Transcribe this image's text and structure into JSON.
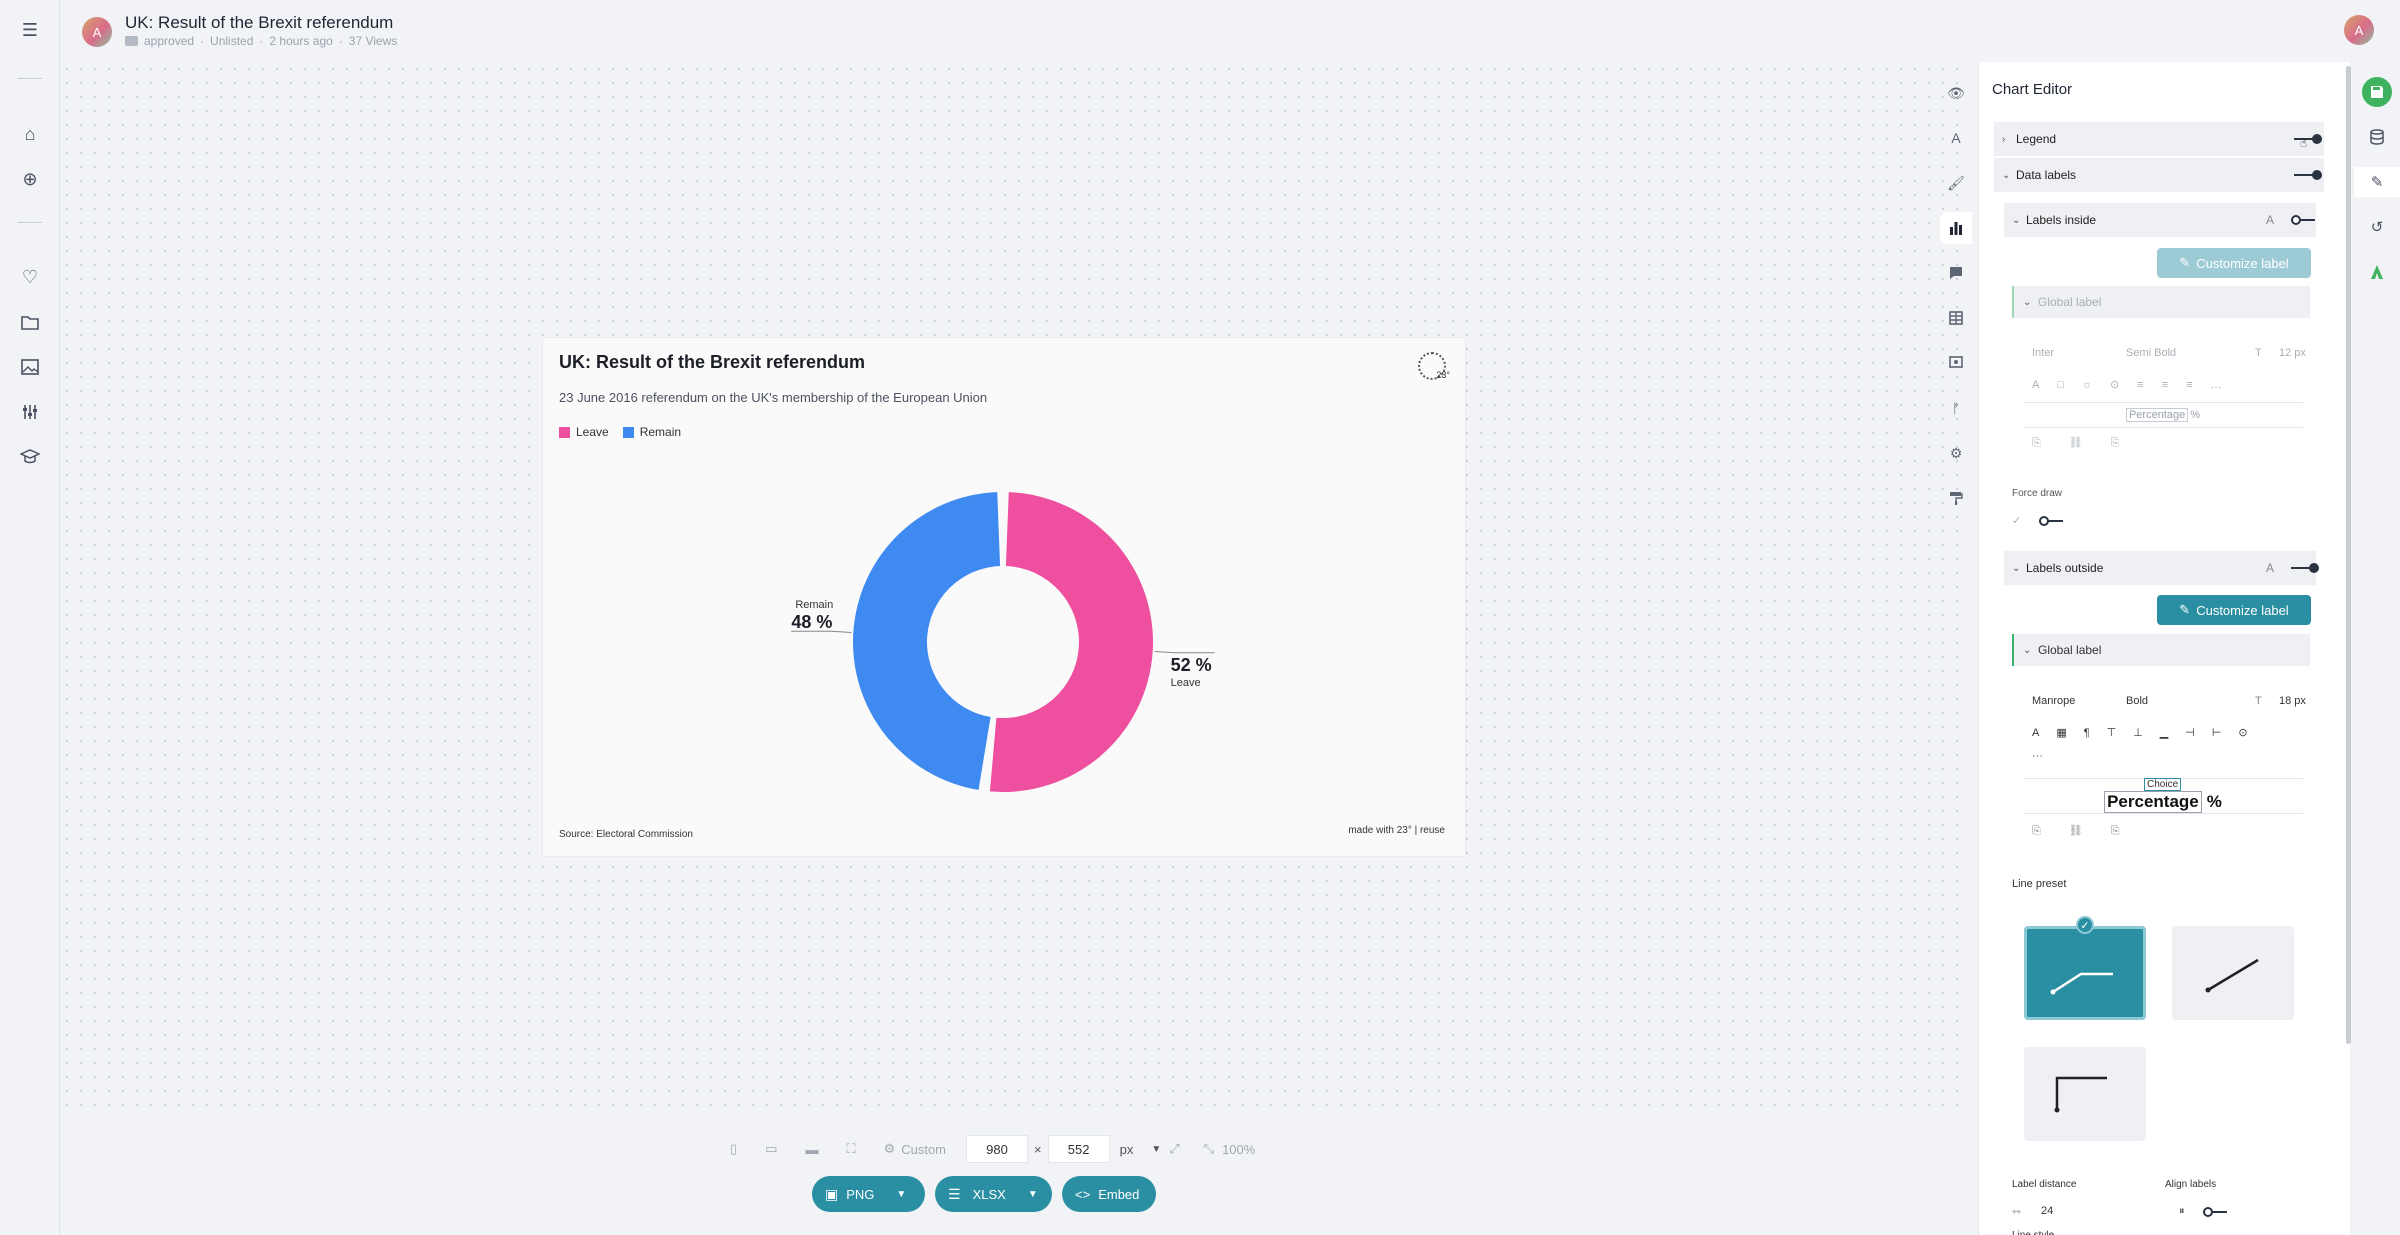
{
  "header": {
    "avatar_initial": "A",
    "title": "UK: Result of the Brexit referendum",
    "status": "approved",
    "visibility": "Unlisted",
    "updated": "2 hours ago",
    "views": "37 Views"
  },
  "chart": {
    "title": "UK: Result of the Brexit referendum",
    "subtitle": "23 June 2016 referendum on the UK's membership of the European Union",
    "source": "Source: Electoral Commission",
    "made_with": "made with 23° | reuse",
    "brand_mark": "23°"
  },
  "chart_data": {
    "type": "pie",
    "title": "UK: Result of the Brexit referendum",
    "subtitle": "23 June 2016 referendum on the UK's membership of the European Union",
    "legend": "top-left",
    "slices": [
      {
        "name": "Leave",
        "value": 52,
        "label": "52 %",
        "color": "#ee4f9f"
      },
      {
        "name": "Remain",
        "value": 48,
        "label": "48 %",
        "color": "#3f8af0"
      }
    ]
  },
  "editor": {
    "title": "Chart Editor",
    "legend_label": "Legend",
    "data_labels_label": "Data labels",
    "labels_inside": "Labels inside",
    "customize_label": "Customize label",
    "global_label": "Global label",
    "inside_font": "Inter",
    "inside_weight": "Semi Bold",
    "inside_size": "12 px",
    "inside_template": "Percentage",
    "percent_sign": "%",
    "force_draw": "Force draw",
    "labels_outside": "Labels outside",
    "outside_font": "Manrope",
    "outside_weight": "Bold",
    "outside_size": "18 px",
    "choice_tag": "Choice",
    "outside_template": "Percentage",
    "line_preset": "Line preset",
    "label_distance": "Label distance",
    "label_distance_value": "24",
    "align_labels": "Align labels",
    "line_style": "Line style"
  },
  "sizebar": {
    "preset": "Custom",
    "width": "980",
    "height": "552",
    "unit": "px",
    "zoom": "100%",
    "times": "×"
  },
  "downloads": {
    "png": "PNG",
    "xlsx": "XLSX",
    "embed": "Embed"
  },
  "colors": {
    "accent": "#2b8fa3",
    "leave": "#ee4f9f",
    "remain": "#3f8af0",
    "save": "#3fb25f"
  }
}
